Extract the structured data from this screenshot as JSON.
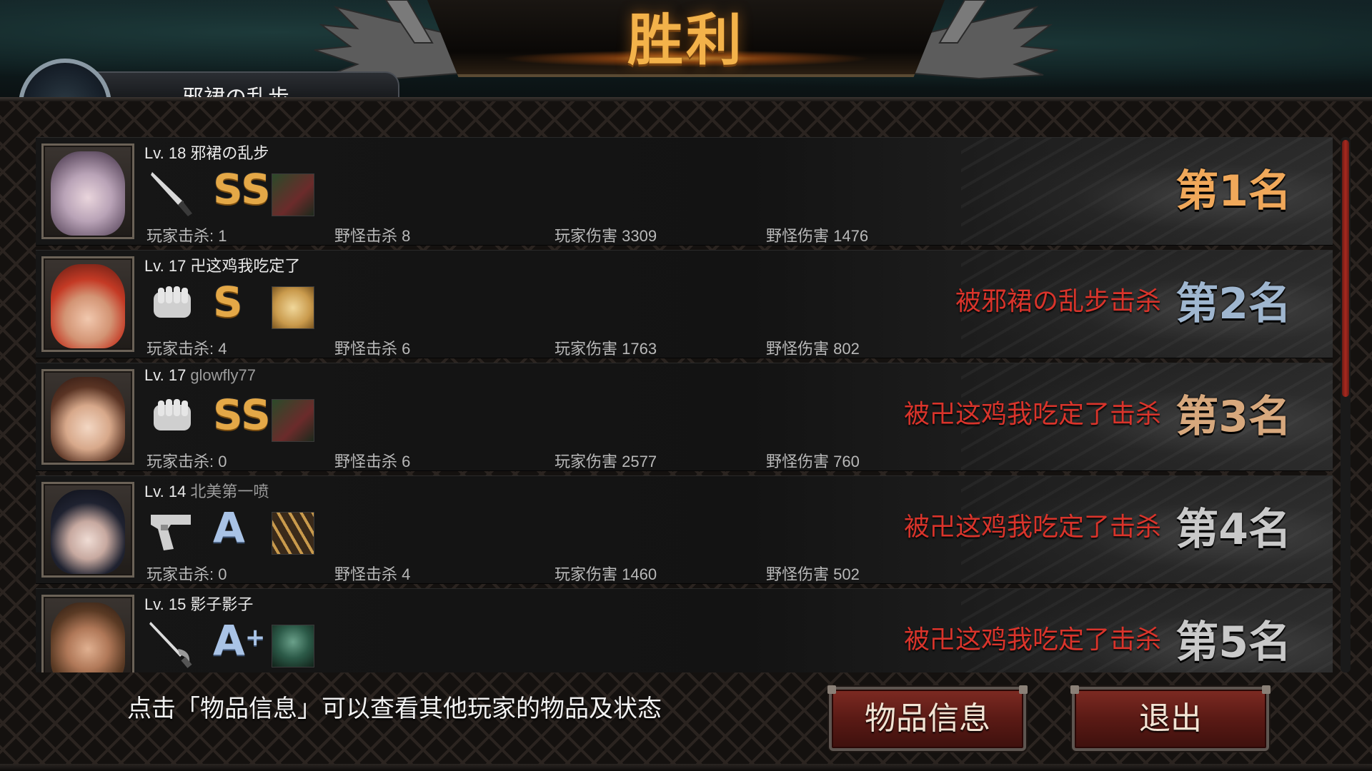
{
  "title": "胜利",
  "header": {
    "player_name": "邪裙の乱步"
  },
  "players": [
    {
      "level_label": "Lv. 18",
      "name": "邪裙の乱步",
      "name_style": "white",
      "weapon_icon": "knife-icon",
      "grade": "SS",
      "grade_color": "#e4a847",
      "item_icon": "character-portrait-icon",
      "player_kills": "玩家击杀: 1",
      "monster_kills": "野怪击杀 8",
      "player_damage": "玩家伤害 3309",
      "monster_damage": "野怪伤害 1476",
      "killed_by": "",
      "rank": "第1名"
    },
    {
      "level_label": "Lv. 17",
      "name": "卍这鸡我吃定了",
      "name_style": "white",
      "weapon_icon": "fist-icon",
      "grade": "S",
      "grade_color": "#e4a847",
      "item_icon": "bread-icon",
      "player_kills": "玩家击杀: 4",
      "monster_kills": "野怪击杀 6",
      "player_damage": "玩家伤害 1763",
      "monster_damage": "野怪伤害 802",
      "killed_by": "被邪裙の乱步击杀",
      "rank": "第2名"
    },
    {
      "level_label": "Lv. 17",
      "name": "glowfly77",
      "name_style": "grey",
      "weapon_icon": "fist-icon",
      "grade": "SS",
      "grade_color": "#e4a847",
      "item_icon": "character-portrait-icon",
      "player_kills": "玩家击杀: 0",
      "monster_kills": "野怪击杀 6",
      "player_damage": "玩家伤害 2577",
      "monster_damage": "野怪伤害 760",
      "killed_by": "被卍这鸡我吃定了击杀",
      "rank": "第3名"
    },
    {
      "level_label": "Lv. 14",
      "name": "北美第一喷",
      "name_style": "grey",
      "weapon_icon": "pistol-icon",
      "grade": "A",
      "grade_color": "#a9c3e6",
      "item_icon": "ammo-icon",
      "player_kills": "玩家击杀: 0",
      "monster_kills": "野怪击杀 4",
      "player_damage": "玩家伤害 1460",
      "monster_damage": "野怪伤害 502",
      "killed_by": "被卍这鸡我吃定了击杀",
      "rank": "第4名"
    },
    {
      "level_label": "Lv. 15",
      "name": "影子影子",
      "name_style": "white",
      "weapon_icon": "rapier-icon",
      "grade": "A",
      "grade_plus": "+",
      "grade_color": "#a9c3e6",
      "item_icon": "soldier-portrait-icon",
      "player_kills": "",
      "monster_kills": "",
      "player_damage": "",
      "monster_damage": "",
      "killed_by": "被卍这鸡我吃定了击杀",
      "rank": "第5名"
    }
  ],
  "footer": {
    "hint": "点击「物品信息」可以查看其他玩家的物品及状态",
    "items_button": "物品信息",
    "exit_button": "退出"
  }
}
